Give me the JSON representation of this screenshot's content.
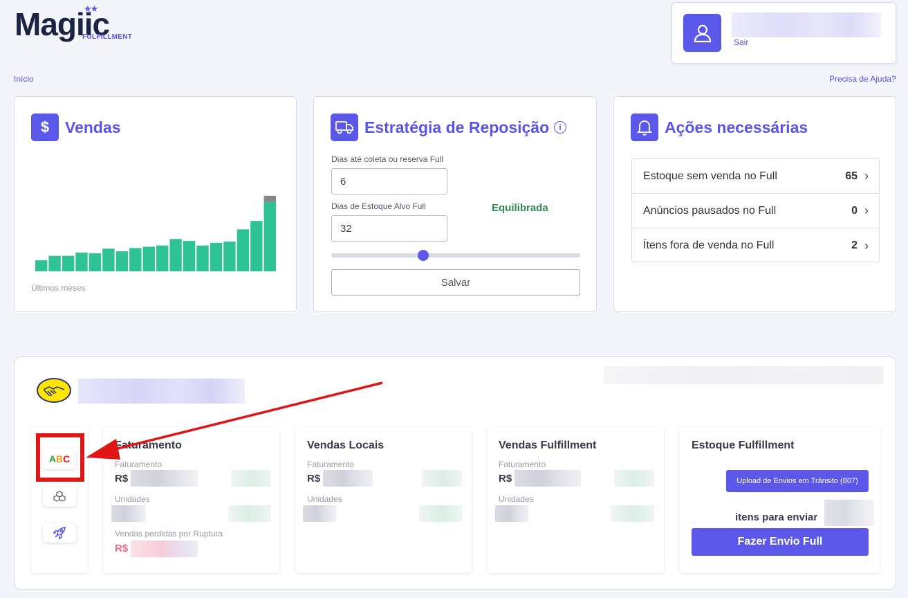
{
  "logo": {
    "text": "Magiic",
    "subtitle": "FULFILLMENT"
  },
  "user": {
    "logout_label": "Sair"
  },
  "nav": {
    "breadcrumb": "Início",
    "help": "Precisa de Ajuda?"
  },
  "sales_card": {
    "title": "Vendas",
    "caption": "Últimos meses",
    "chart_data": {
      "type": "bar",
      "values": [
        17,
        24,
        24,
        29,
        28,
        35,
        31,
        36,
        38,
        40,
        50,
        47,
        40,
        44,
        46,
        65,
        78,
        107
      ],
      "highlight_last_extra": 10,
      "colors": {
        "bar": "#2ec394",
        "top": "#888888"
      }
    }
  },
  "strategy_card": {
    "title": "Estratégia de Reposição",
    "field1_label": "Dias até coleta ou reserva Full",
    "field1_value": "6",
    "field2_label": "Dias de Estoque Alvo Full",
    "field2_value": "32",
    "status": "Equilibrada",
    "slider_value": 0.37,
    "save_label": "Salvar"
  },
  "actions_card": {
    "title": "Ações necessárias",
    "rows": [
      {
        "label": "Estoque sem venda no Full",
        "count": "65"
      },
      {
        "label": "Anúncios pausados no Full",
        "count": "0"
      },
      {
        "label": "Ítens fora de venda no Full",
        "count": "2"
      }
    ]
  },
  "store": {
    "tools": [
      "abc-curve",
      "boxes",
      "rocket"
    ],
    "abc_label": {
      "a": "A",
      "b": "B",
      "c": "C"
    },
    "faturamento": {
      "title": "Faturamento",
      "label1": "Faturamento",
      "currency": "R$",
      "label2": "Unidades",
      "label3": "Vendas perdidas por Ruptura"
    },
    "vendas_locais": {
      "title": "Vendas Locais",
      "label1": "Faturamento",
      "currency": "R$",
      "label2": "Unidades"
    },
    "vendas_full": {
      "title": "Vendas Fulfillment",
      "label1": "Faturamento",
      "currency": "R$",
      "label2": "Unidades"
    },
    "estoque_full": {
      "title": "Estoque Fulfillment",
      "upload_label": "Upload de Envios em Trânsito (807)",
      "items_label": "itens para enviar",
      "submit_label": "Fazer Envio Full"
    }
  },
  "colors": {
    "accent": "#5b57e8",
    "success_text": "#2e8b4f",
    "annotation": "#e01515"
  }
}
